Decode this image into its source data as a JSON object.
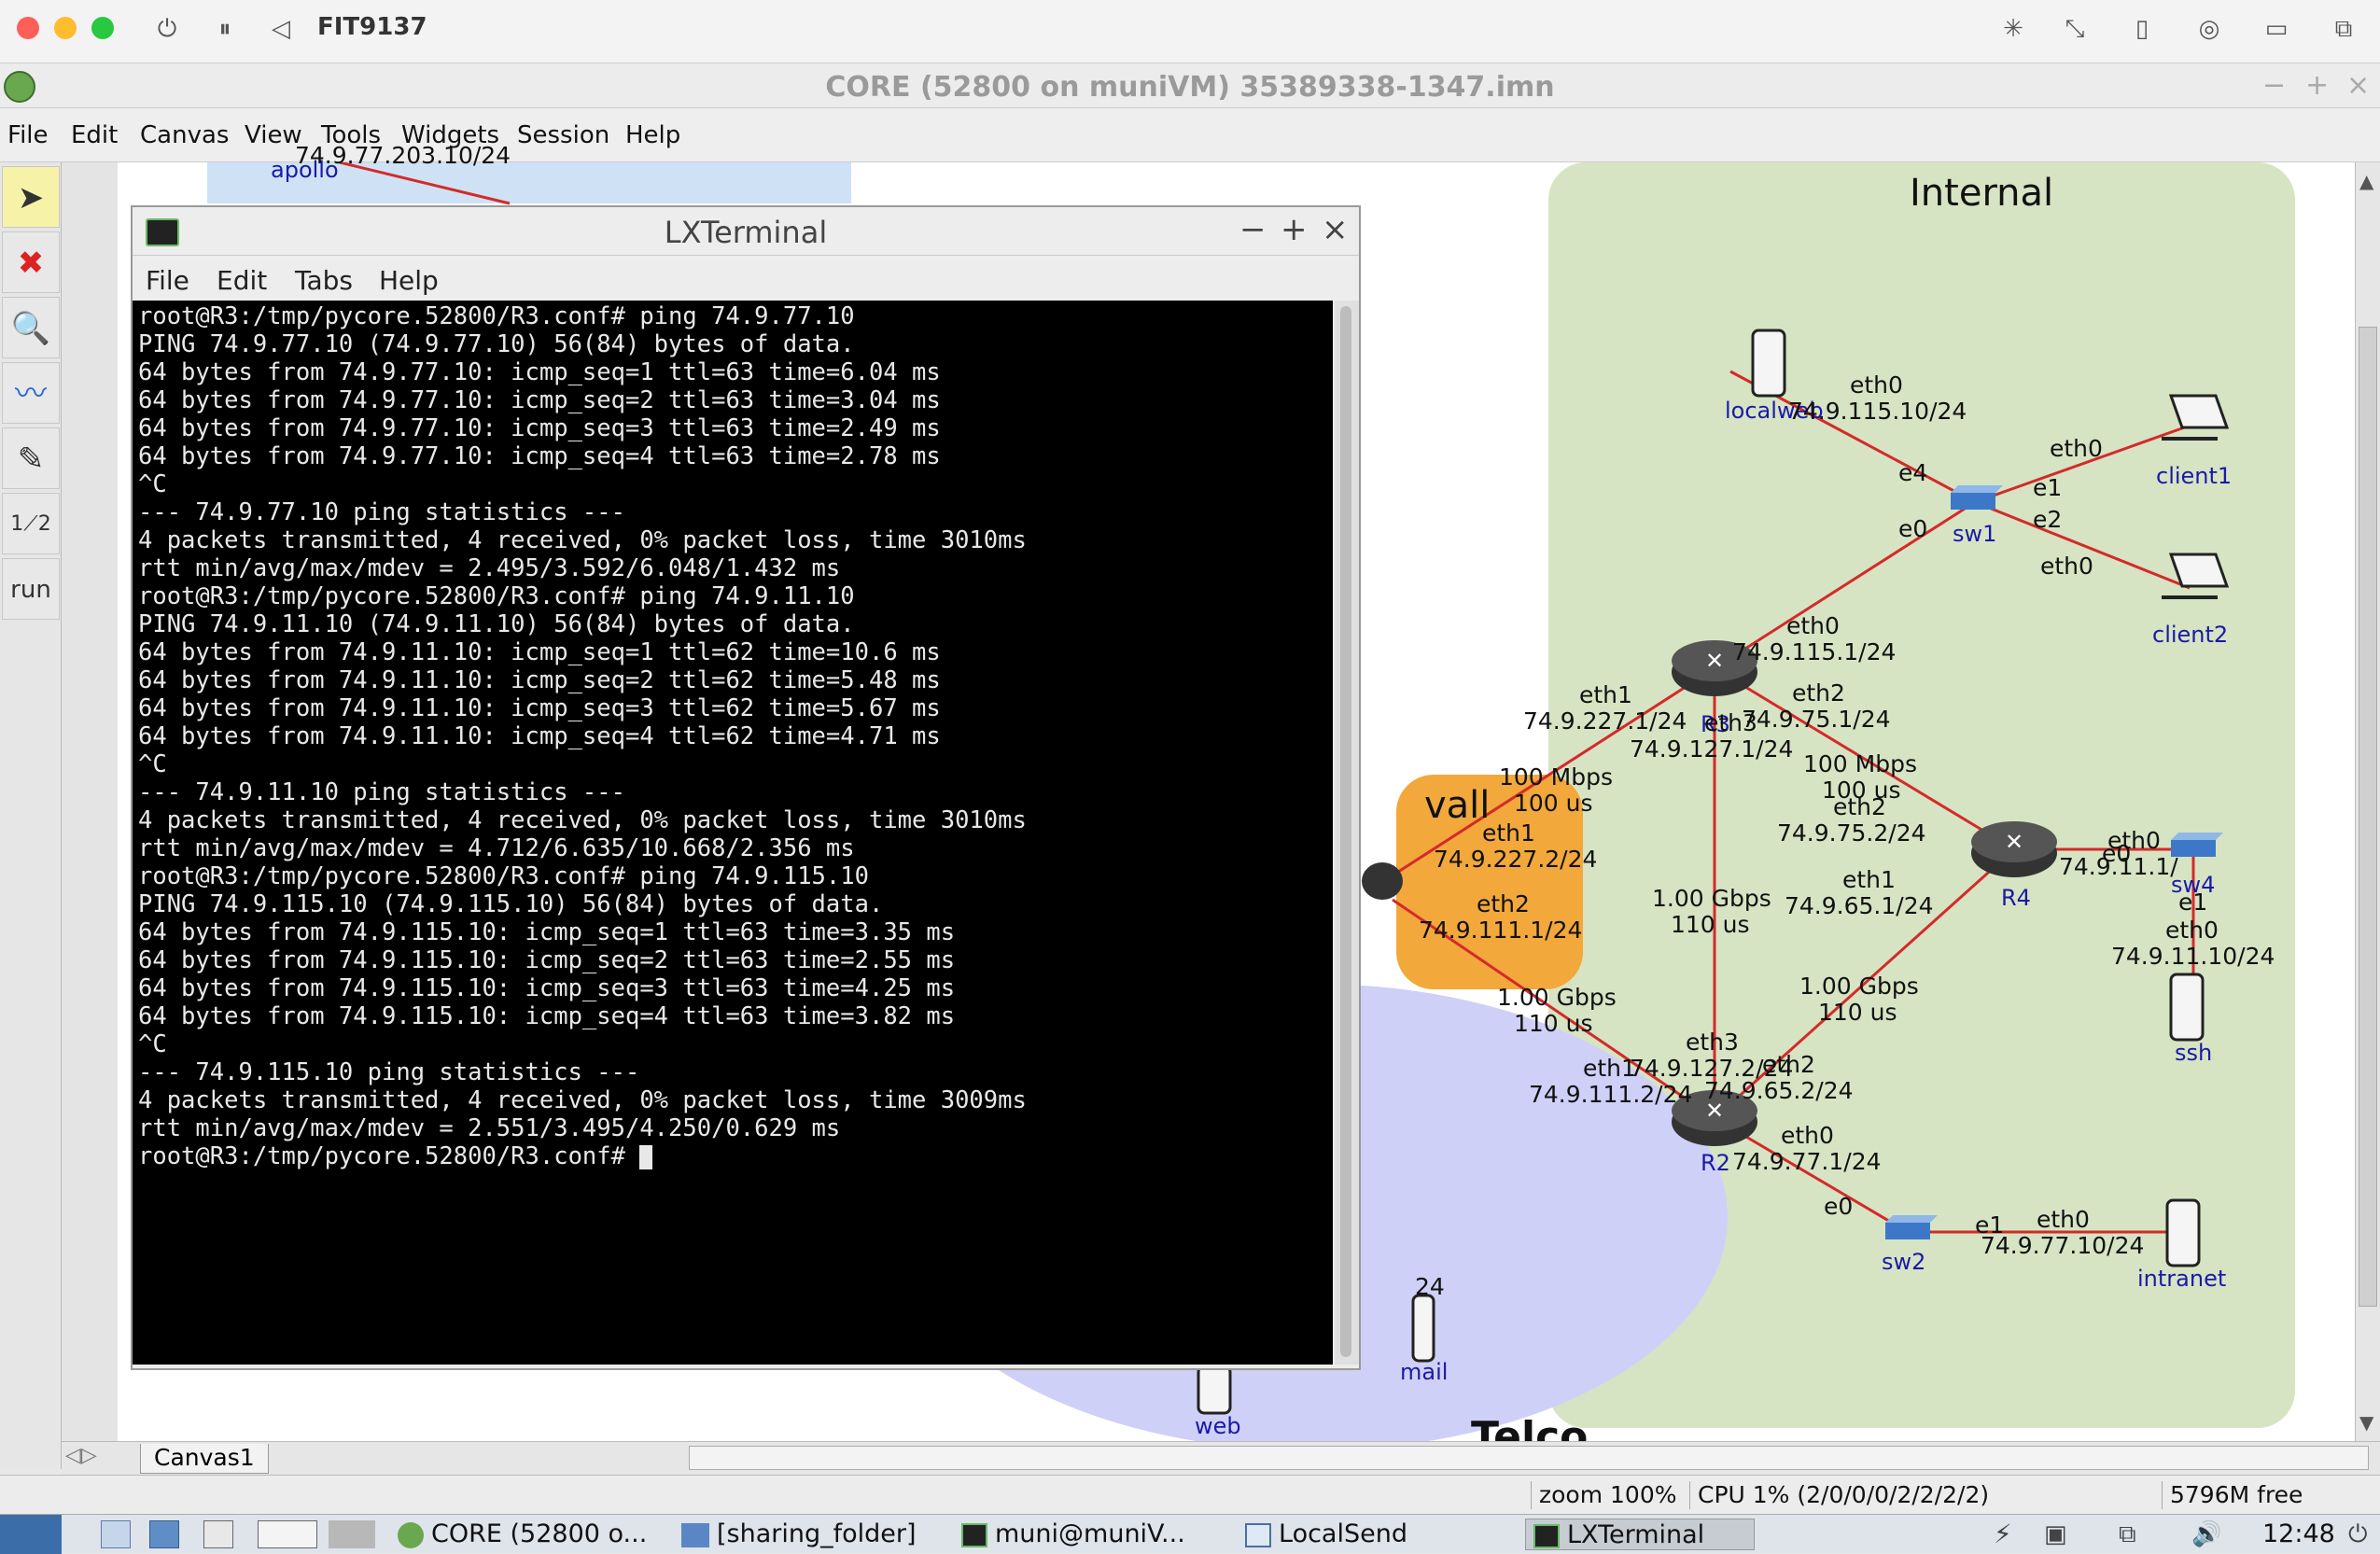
{
  "host": {
    "vm_title": "FIT9137"
  },
  "core_window": {
    "title": "CORE (52800 on muniVM) 35389338-1347.imn",
    "menus": [
      "File",
      "Edit",
      "Canvas",
      "View",
      "Tools",
      "Widgets",
      "Session",
      "Help"
    ],
    "run_label": "run"
  },
  "canvas": {
    "zones": {
      "internal": "Internal",
      "firewall_partial": "vall",
      "telco_partial": "Telco"
    },
    "nodes": {
      "apollo": "apollo",
      "localweb": "localweb",
      "client1": "client1",
      "client2": "client2",
      "sw1": "sw1",
      "r3": "R3",
      "r4": "R4",
      "sw4": "sw4",
      "ssh": "ssh",
      "r2": "R2",
      "sw2": "sw2",
      "intranet": "intranet",
      "web": "web",
      "mail": "mail"
    },
    "labels": {
      "apollo_ip": "74.9.77.203.10/24",
      "lw_eth0": "eth0",
      "lw_ip": "74.9.115.10/24",
      "sw1_e4": "e4",
      "sw1_e0": "e0",
      "sw1_e1": "e1",
      "sw1_e2": "e2",
      "c1_eth0": "eth0",
      "c2_eth0": "eth0",
      "r3_eth0": "eth0",
      "r3_eth0_ip": "74.9.115.1/24",
      "r3_eth1": "eth1",
      "r3_eth1_ip": "74.9.227.1/24",
      "r3_eth3": "eth3",
      "r3_eth3_ip": "74.9.127.1/24",
      "r3_eth2": "eth2",
      "r3_eth2_ip": "74.9.75.1/24",
      "link_100": "100 Mbps",
      "link_100_delay": "100 us",
      "link_100b": "100 Mbps",
      "link_100b_delay": "100 us",
      "r4_eth2": "eth2",
      "r4_eth2_ip": "74.9.75.2/24",
      "r4_eth1": "eth1",
      "r4_eth1_ip": "74.9.65.1/24",
      "r4_eth0": "eth0",
      "r4_eth0_ip": "74.9.11.1/",
      "sw4_e0": "e0",
      "sw4_e1": "e1",
      "ssh_eth0": "eth0",
      "ssh_ip": "74.9.11.10/24",
      "fw_eth1": "eth1",
      "fw_eth1_ip": "74.9.227.2/24",
      "fw_eth2": "eth2",
      "fw_eth2_ip": "74.9.111.1/24",
      "link_1g_a": "1.00 Gbps",
      "link_1g_a_delay": "110 us",
      "link_1g_b": "1.00 Gbps",
      "link_1g_b_delay": "110 us",
      "link_1g_c": "1.00 Gbps",
      "link_1g_c_delay": "110 us",
      "r2_eth3": "eth3",
      "r2_eth3_ip": "74.9.127.2/24",
      "r2_eth1": "eth1",
      "r2_eth1_ip": "74.9.111.2/24",
      "r2_eth2": "eth2",
      "r2_eth2_ip": "74.9.65.2/24",
      "r2_eth0": "eth0",
      "r2_eth0_ip": "74.9.77.1/24",
      "sw2_e0": "e0",
      "sw2_e1": "e1",
      "intranet_eth0": "eth0",
      "intranet_ip": "74.9.77.10/24",
      "mail_partial": "24"
    },
    "tab": "Canvas1"
  },
  "status": {
    "zoom": "zoom 100%",
    "cpu": "CPU 1% (2/0/0/0/2/2/2/2)",
    "mem": "5796M free"
  },
  "terminal": {
    "title": "LXTerminal",
    "menus": [
      "File",
      "Edit",
      "Tabs",
      "Help"
    ],
    "lines": [
      "root@R3:/tmp/pycore.52800/R3.conf# ping 74.9.77.10",
      "PING 74.9.77.10 (74.9.77.10) 56(84) bytes of data.",
      "64 bytes from 74.9.77.10: icmp_seq=1 ttl=63 time=6.04 ms",
      "64 bytes from 74.9.77.10: icmp_seq=2 ttl=63 time=3.04 ms",
      "64 bytes from 74.9.77.10: icmp_seq=3 ttl=63 time=2.49 ms",
      "64 bytes from 74.9.77.10: icmp_seq=4 ttl=63 time=2.78 ms",
      "^C",
      "--- 74.9.77.10 ping statistics ---",
      "4 packets transmitted, 4 received, 0% packet loss, time 3010ms",
      "rtt min/avg/max/mdev = 2.495/3.592/6.048/1.432 ms",
      "root@R3:/tmp/pycore.52800/R3.conf# ping 74.9.11.10",
      "PING 74.9.11.10 (74.9.11.10) 56(84) bytes of data.",
      "64 bytes from 74.9.11.10: icmp_seq=1 ttl=62 time=10.6 ms",
      "64 bytes from 74.9.11.10: icmp_seq=2 ttl=62 time=5.48 ms",
      "64 bytes from 74.9.11.10: icmp_seq=3 ttl=62 time=5.67 ms",
      "64 bytes from 74.9.11.10: icmp_seq=4 ttl=62 time=4.71 ms",
      "^C",
      "--- 74.9.11.10 ping statistics ---",
      "4 packets transmitted, 4 received, 0% packet loss, time 3010ms",
      "rtt min/avg/max/mdev = 4.712/6.635/10.668/2.356 ms",
      "root@R3:/tmp/pycore.52800/R3.conf# ping 74.9.115.10",
      "PING 74.9.115.10 (74.9.115.10) 56(84) bytes of data.",
      "64 bytes from 74.9.115.10: icmp_seq=1 ttl=63 time=3.35 ms",
      "64 bytes from 74.9.115.10: icmp_seq=2 ttl=63 time=2.55 ms",
      "64 bytes from 74.9.115.10: icmp_seq=3 ttl=63 time=4.25 ms",
      "64 bytes from 74.9.115.10: icmp_seq=4 ttl=63 time=3.82 ms",
      "^C",
      "--- 74.9.115.10 ping statistics ---",
      "4 packets transmitted, 4 received, 0% packet loss, time 3009ms",
      "rtt min/avg/max/mdev = 2.551/3.495/4.250/0.629 ms"
    ],
    "prompt": "root@R3:/tmp/pycore.52800/R3.conf# "
  },
  "taskbar": {
    "items": [
      "CORE (52800 o...",
      "[sharing_folder]",
      "muni@muniV...",
      "LocalSend",
      "LXTerminal"
    ],
    "clock": "12:48"
  },
  "colors": {
    "internal_zone": "#d6e4c3",
    "firewall_zone": "#f2a83b",
    "link": "#d42a2a",
    "node_label": "#1a1aa8"
  }
}
